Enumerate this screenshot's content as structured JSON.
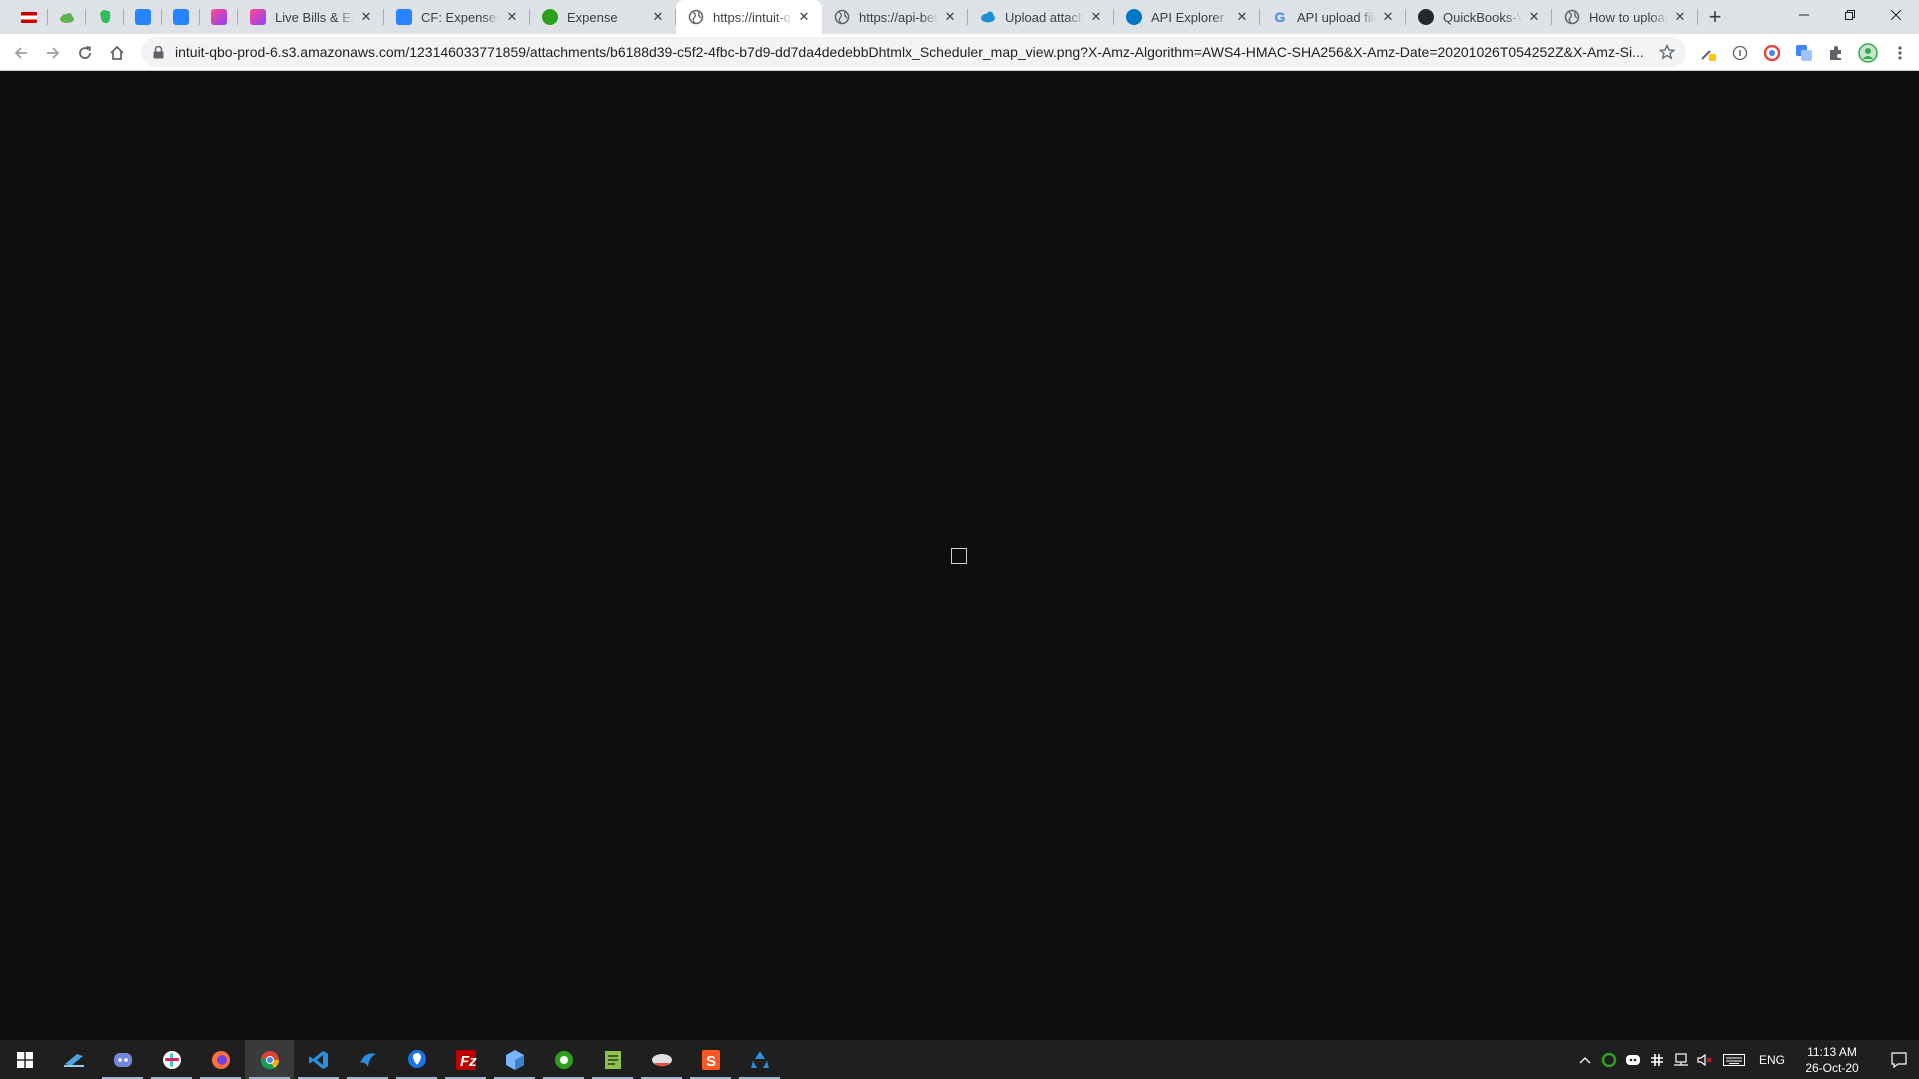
{
  "tabs": [
    {
      "title": "Live Bills & Exp",
      "icon": "quickbooks-icon"
    },
    {
      "title": "CF: Expenses: C",
      "icon": "confluence-icon"
    },
    {
      "title": "Expense",
      "icon": "quickbooks-icon"
    },
    {
      "title": "https://intuit-q",
      "icon": "globe-icon",
      "active": true
    },
    {
      "title": "https://api-beta",
      "icon": "globe-icon"
    },
    {
      "title": "Upload attachm",
      "icon": "cloud-icon"
    },
    {
      "title": "API Explorer",
      "icon": "intuit-icon"
    },
    {
      "title": "API upload file",
      "icon": "google-icon"
    },
    {
      "title": "QuickBooks-V3",
      "icon": "github-icon"
    },
    {
      "title": "How to upload",
      "icon": "globe-icon"
    }
  ],
  "pinned_tabs": [
    "flag-icon",
    "cloud-icon",
    "evernote-icon",
    "jira-icon",
    "jira-icon",
    "app-icon"
  ],
  "address_bar": {
    "url": "intuit-qbo-prod-6.s3.amazonaws.com/123146033771859/attachments/b6188d39-c5f2-4fbc-b7d9-dd7da4dedebbDhtmlx_Scheduler_map_view.png?X-Amz-Algorithm=AWS4-HMAC-SHA256&X-Amz-Date=20201026T054252Z&X-Amz-Si..."
  },
  "taskbar": {
    "language": "ENG",
    "time": "11:13 AM",
    "date": "26-Oct-20"
  },
  "colors": {
    "tabstrip": "#dee1e6",
    "viewport": "#0e0e0e",
    "taskbar": "#1f1f1f"
  }
}
